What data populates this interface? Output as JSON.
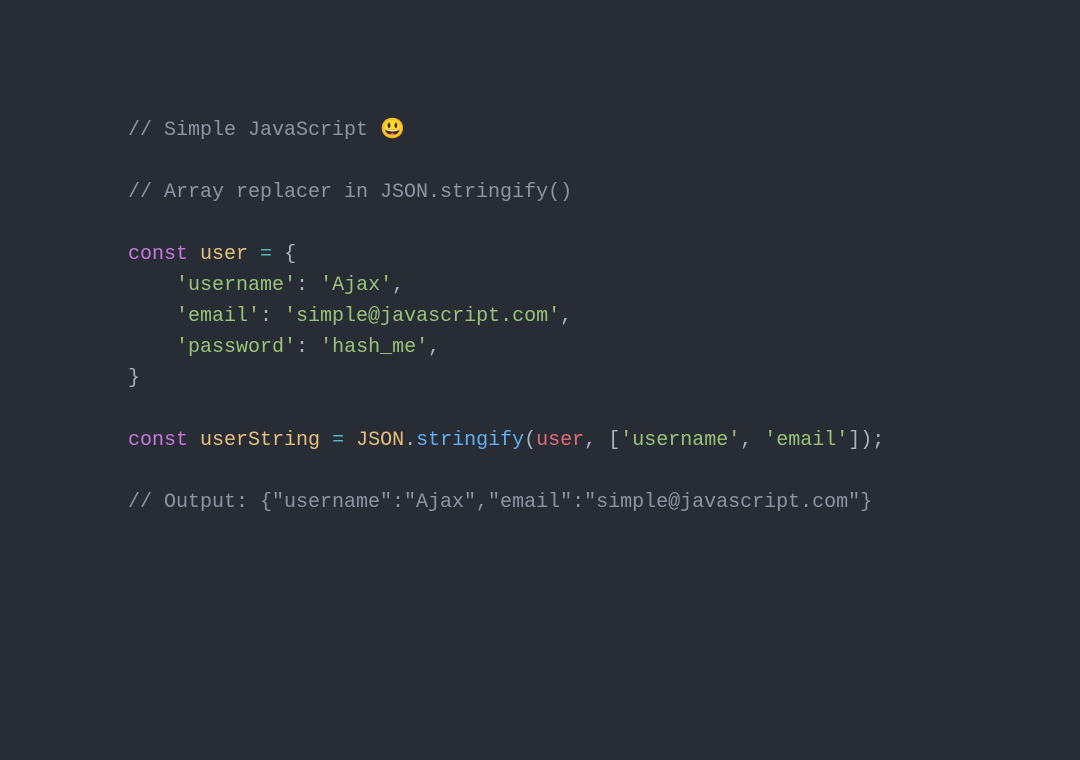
{
  "code": {
    "comment1_pre": "// Simple JavaScript ",
    "emoji": "😃",
    "comment2": "// Array replacer in JSON.stringify()",
    "kw_const": "const",
    "var_user": "user",
    "eq": " = ",
    "brace_open": "{",
    "key_username": "'username'",
    "colon": ": ",
    "val_username": "'Ajax'",
    "comma": ",",
    "key_email": "'email'",
    "val_email": "'simple@javascript.com'",
    "key_password": "'password'",
    "val_password": "'hash_me'",
    "brace_close": "}",
    "var_userString": "userString",
    "json_obj": "JSON",
    "dot": ".",
    "stringify": "stringify",
    "paren_open": "(",
    "arg_user": "user",
    "comma_sp": ", ",
    "bracket_open": "[",
    "arr_username": "'username'",
    "arr_email": "'email'",
    "bracket_close": "]",
    "paren_close": ")",
    "semi": ";",
    "comment3": "// Output: {\"username\":\"Ajax\",\"email\":\"simple@javascript.com\"}",
    "indent": "    "
  }
}
